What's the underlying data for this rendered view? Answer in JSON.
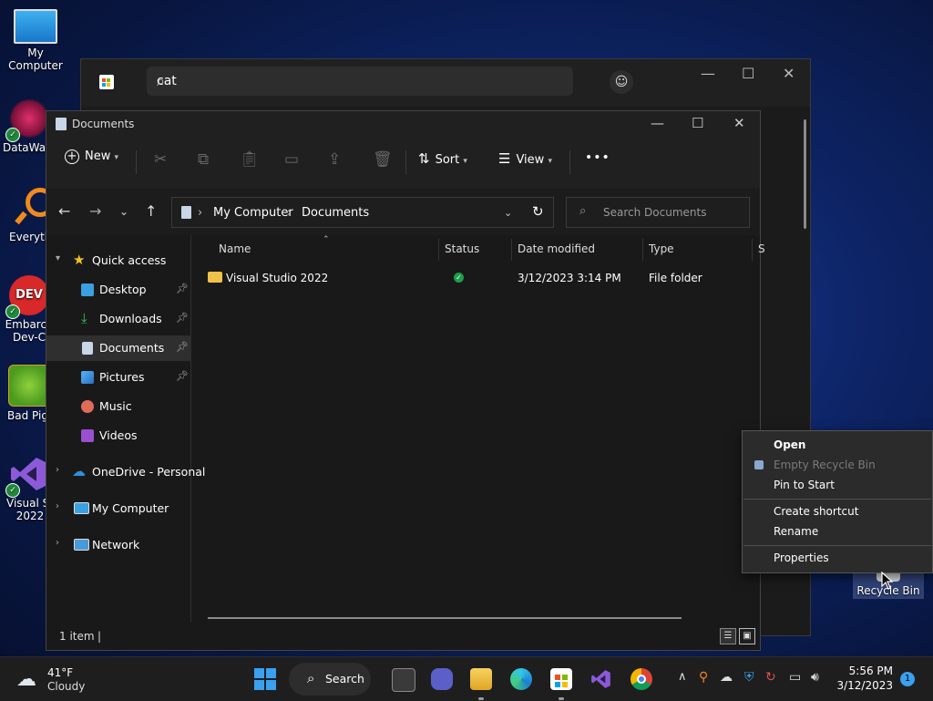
{
  "desktop": {
    "icons": [
      {
        "label": "My Computer"
      },
      {
        "label": "DataWag"
      },
      {
        "label": "Everyth"
      },
      {
        "label": "Embarca Dev-C"
      },
      {
        "label": "Bad Pig"
      },
      {
        "label": "Visual St 2022"
      },
      {
        "label": "Recycle Bin"
      }
    ]
  },
  "store": {
    "search_value": "cat"
  },
  "explorer": {
    "title": "Documents",
    "toolbar": {
      "new_label": "New",
      "sort_label": "Sort",
      "view_label": "View",
      "more_label": "•••"
    },
    "breadcrumb": [
      "My Computer",
      "Documents"
    ],
    "search_placeholder": "Search Documents",
    "sidebar": {
      "quick_access": "Quick access",
      "items": [
        {
          "label": "Desktop"
        },
        {
          "label": "Downloads"
        },
        {
          "label": "Documents"
        },
        {
          "label": "Pictures"
        },
        {
          "label": "Music"
        },
        {
          "label": "Videos"
        }
      ],
      "onedrive": "OneDrive - Personal",
      "my_computer": "My Computer",
      "network": "Network"
    },
    "columns": [
      "Name",
      "Status",
      "Date modified",
      "Type",
      "S"
    ],
    "rows": [
      {
        "name": "Visual Studio 2022",
        "date": "3/12/2023 3:14 PM",
        "type": "File folder"
      }
    ],
    "status": "1 item"
  },
  "context_menu": {
    "items": [
      "Open",
      "Empty Recycle Bin",
      "Pin to Start",
      "Create shortcut",
      "Rename",
      "Properties"
    ]
  },
  "taskbar": {
    "weather_temp": "41°F",
    "weather_desc": "Cloudy",
    "search_label": "Search",
    "time": "5:56 PM",
    "date": "3/12/2023",
    "notification_count": "1"
  },
  "colors": {
    "accent": "#0078d4",
    "folder": "#f0c24a",
    "status_green": "#1f9d4a"
  }
}
